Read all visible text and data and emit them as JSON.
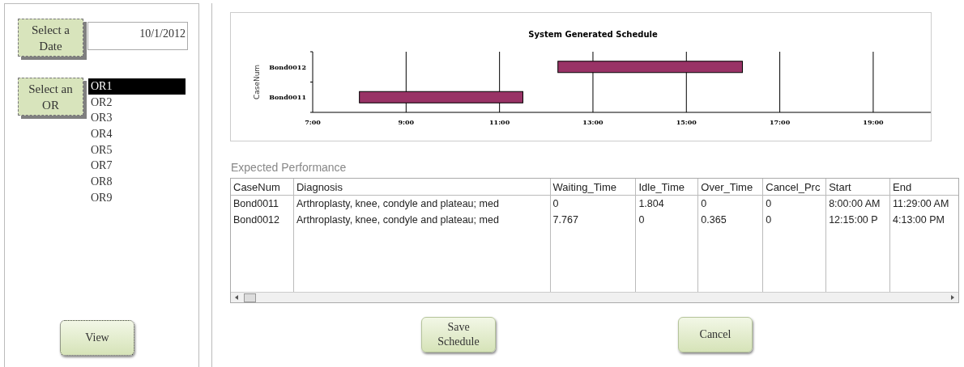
{
  "date_picker": {
    "button": "Select a\nDate",
    "value": "10/1/2012"
  },
  "or_picker": {
    "button": "Select an\nOR",
    "items": [
      {
        "label": "OR1",
        "selected": true
      },
      {
        "label": "OR2",
        "selected": false
      },
      {
        "label": "OR3",
        "selected": false
      },
      {
        "label": "OR4",
        "selected": false
      },
      {
        "label": "OR5",
        "selected": false
      },
      {
        "label": "OR7",
        "selected": false
      },
      {
        "label": "OR8",
        "selected": false
      },
      {
        "label": "OR9",
        "selected": false
      }
    ]
  },
  "view_button": "View",
  "schedule": {
    "chart_data": {
      "type": "bar",
      "orientation": "horizontal",
      "title": "System Generated Schedule",
      "ylabel": "CaseNum",
      "categories": [
        "Bond0012",
        "Bond0011"
      ],
      "series": [
        {
          "color": "#993366",
          "base": [
            12.25,
            8
          ],
          "values": [
            3.95,
            3.5
          ]
        }
      ],
      "grid": true,
      "xlim": [
        7,
        20.25
      ],
      "xticks": [
        {
          "value": 7,
          "label": "7:00"
        },
        {
          "value": 9,
          "label": "9:00"
        },
        {
          "value": 11,
          "label": "11:00"
        },
        {
          "value": 13,
          "label": "13:00"
        },
        {
          "value": 15,
          "label": "15:00"
        },
        {
          "value": 17,
          "label": "17:00"
        },
        {
          "value": 19,
          "label": "19:00"
        }
      ]
    }
  },
  "performance": {
    "title": "Expected Performance",
    "columns": [
      "CaseNum",
      "Diagnosis",
      "Waiting_Time",
      "Idle_Time",
      "Over_Time",
      "Cancel_Prc",
      "Start",
      "End"
    ],
    "rows": [
      [
        "Bond0011",
        "Arthroplasty, knee, condyle and plateau; med",
        "0",
        "1.804",
        "0",
        "0",
        "8:00:00 AM",
        "11:29:00 AM"
      ],
      [
        "Bond0012",
        "Arthroplasty, knee, condyle and plateau; med",
        "7.767",
        "0",
        "0.365",
        "0",
        "12:15:00 P",
        "4:13:00 PM"
      ]
    ]
  },
  "buttons": [
    "Save\nSchedule",
    "Cancel"
  ]
}
